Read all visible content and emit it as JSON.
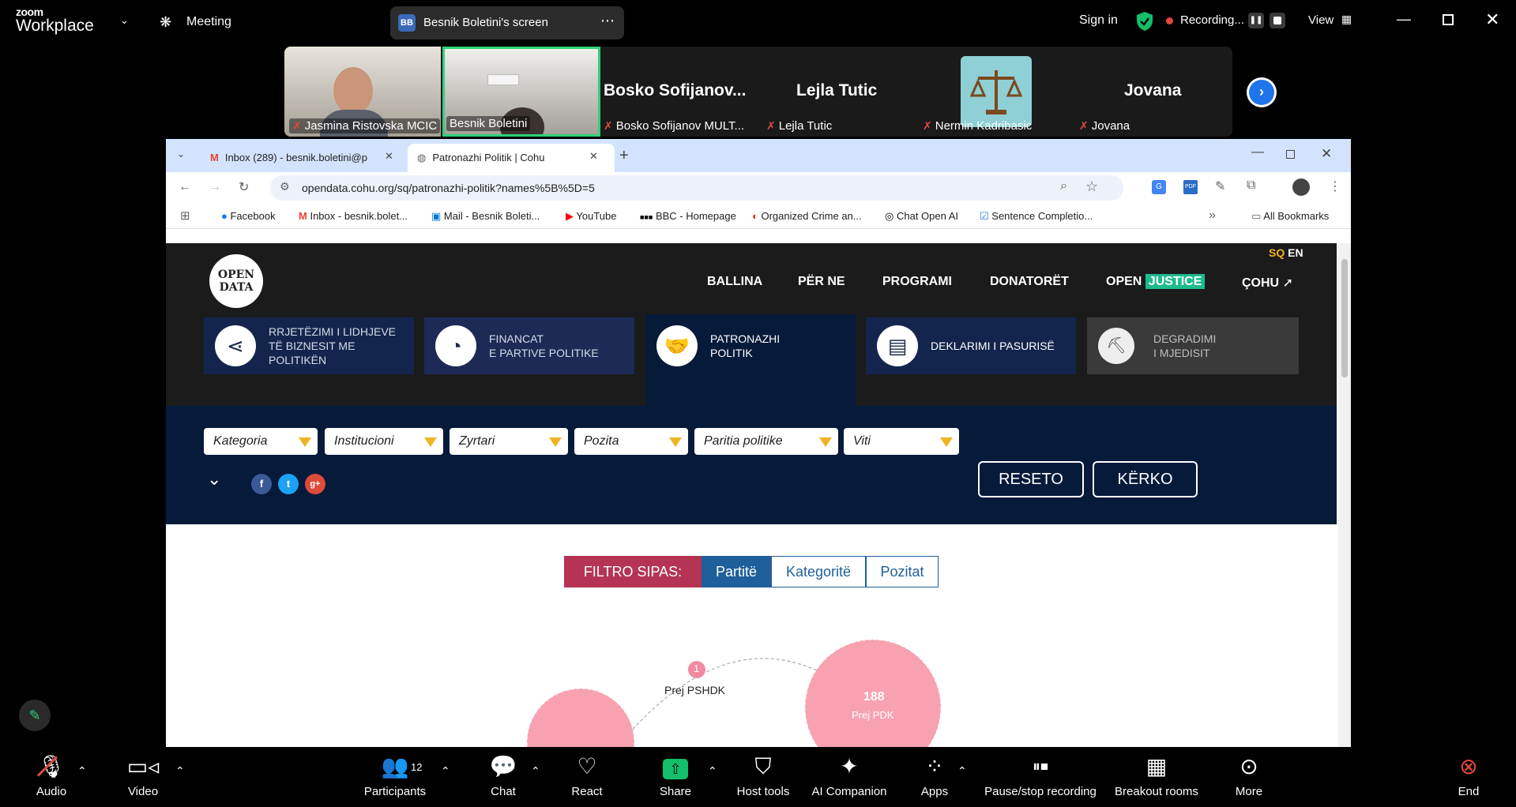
{
  "zoom": {
    "brand_top": "zoom",
    "brand_bottom": "Workplace",
    "meeting_label": "Meeting",
    "screen_share": {
      "initials": "BB",
      "label": "Besnik Boletini's screen"
    },
    "sign_in": "Sign in",
    "recording_label": "Recording...",
    "view_label": "View"
  },
  "participants": [
    {
      "name": "Jasmina Ristovska MCIC",
      "type": "video"
    },
    {
      "name": "Besnik Boletini",
      "type": "video",
      "active": true
    },
    {
      "name": "Bosko Sofijanov MULT...",
      "display": "Bosko  Sofijanov...",
      "type": "name"
    },
    {
      "name": "Lejla Tutic",
      "display": "Lejla Tutic",
      "type": "name"
    },
    {
      "name": "Nermin Kadribasic",
      "type": "avatar"
    },
    {
      "name": "Jovana",
      "display": "Jovana",
      "type": "name"
    }
  ],
  "browser": {
    "tabs": [
      {
        "label": "Inbox (289) - besnik.boletini@p",
        "active": false
      },
      {
        "label": "Patronazhi Politik | Cohu",
        "active": true
      }
    ],
    "url": "opendata.cohu.org/sq/patronazhi-politik?names%5B%5D=5",
    "bookmarks": [
      "Facebook",
      "Inbox - besnik.bolet...",
      "Mail - Besnik Boleti...",
      "YouTube",
      "BBC - Homepage",
      "Organized Crime an...",
      "Chat Open AI",
      "Sentence Completio..."
    ],
    "all_bookmarks": "All Bookmarks"
  },
  "site": {
    "lang_sq": "SQ",
    "lang_en": "EN",
    "logo_line1": "OPEN",
    "logo_line2": "DATA",
    "nav": [
      "BALLINA",
      "PËR NE",
      "PROGRAMI",
      "DONATORËT"
    ],
    "nav_open": "OPEN",
    "nav_justice": "JUSTICE",
    "nav_cohu": "ÇOHU",
    "cards": [
      {
        "line1": "Rrjetëzimi i lidhjeve",
        "line2": "të biznesit me",
        "line3": "politikën"
      },
      {
        "line1": "Financat",
        "line2": "e partive politike",
        "line3": ""
      },
      {
        "line1": "Patronazhi",
        "line2": "politik",
        "line3": ""
      },
      {
        "line1": "Deklarimi i pasurisë",
        "line2": "",
        "line3": ""
      },
      {
        "line1": "Degradimi",
        "line2": "i mjedisit",
        "line3": ""
      }
    ],
    "filters": [
      "Kategoria",
      "Institucioni",
      "Zyrtari",
      "Pozita",
      "Paritia politike",
      "Viti"
    ],
    "reset": "RESETO",
    "search": "KËRKO",
    "filter_by": "FILTRO SIPAS:",
    "filter_tabs": [
      "Partitë",
      "Kategoritë",
      "Pozitat"
    ],
    "bubble_badge": "1",
    "link_label": "Prej PSHDK",
    "bubble_value": "188",
    "bubble_label": "Prej PDK"
  },
  "toolbar": {
    "audio": "Audio",
    "video": "Video",
    "participants": "Participants",
    "participant_count": "12",
    "chat": "Chat",
    "react": "React",
    "share": "Share",
    "host_tools": "Host tools",
    "ai_companion": "AI Companion",
    "apps": "Apps",
    "pause_stop": "Pause/stop recording",
    "breakout": "Breakout rooms",
    "more": "More",
    "end": "End"
  },
  "colors": {
    "zoom_bg": "#000000",
    "share_green": "#12c06a",
    "site_dark": "#1b1b1b",
    "filter_navy": "#061a3a",
    "accent_yellow": "#f0b323",
    "justice_teal": "#1dbb8e",
    "bubble_pink": "#f7a1b1",
    "filter_label_red": "#b53454",
    "tab_blue": "#1f5f9a"
  }
}
